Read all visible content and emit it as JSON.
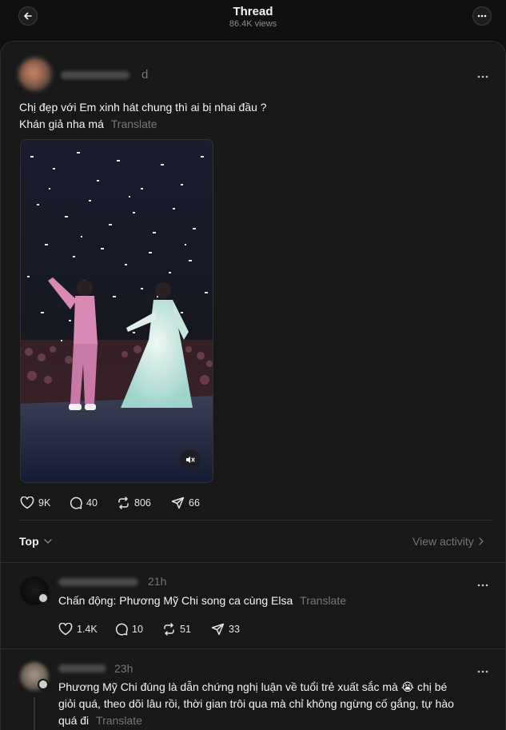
{
  "header": {
    "title": "Thread",
    "views": "86.4K views",
    "back_icon": "arrow-left-icon",
    "more_icon": "more-horizontal-icon"
  },
  "post": {
    "time": "d",
    "text_line1": "Chị đẹp với Em xinh hát chung thì ai bị nhai đầu ?",
    "text_line2": "Khán giả nha má",
    "translate_label": "Translate",
    "likes": "9K",
    "comments": "40",
    "reposts": "806",
    "shares": "66"
  },
  "sort": {
    "label": "Top",
    "view_activity": "View activity"
  },
  "replies": [
    {
      "time": "21h",
      "text": "Chấn động: Phương Mỹ Chi song ca cùng Elsa",
      "translate_label": "Translate",
      "likes": "1.4K",
      "comments": "10",
      "reposts": "51",
      "shares": "33"
    },
    {
      "time": "23h",
      "text_line1": "Phương Mỹ Chi đúng là dẫn chứng nghị luận về tuổi trẻ xuất sắc mà",
      "emoji": "😭",
      "text_line1b": "chị bé",
      "text_line2": "giỏi quá, theo dõi lâu rồi, thời gian trôi qua mà chỉ không ngừng cố gắng, tự hào",
      "text_line3": "quá đi",
      "translate_label": "Translate"
    }
  ],
  "colors": {
    "background": "#101010",
    "panel": "#181818",
    "muted_text": "#777777",
    "primary_text": "#f3f5f7"
  }
}
